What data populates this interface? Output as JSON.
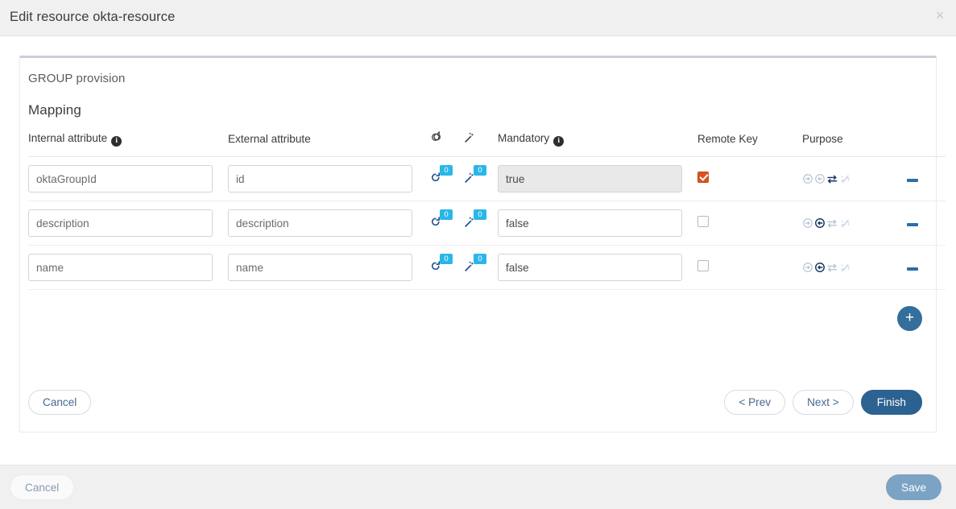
{
  "header": {
    "title": "Edit resource okta-resource",
    "close_label": "×"
  },
  "panel": {
    "provision_title": "GROUP provision",
    "section_title": "Mapping"
  },
  "table": {
    "headers": {
      "internal": "Internal attribute",
      "external": "External attribute",
      "refresh_icon": "refresh-icon",
      "wand_icon": "magic-wand-icon",
      "mandatory": "Mandatory",
      "remote_key": "Remote Key",
      "purpose": "Purpose",
      "info_glyph": "i"
    },
    "rows": [
      {
        "internal": "oktaGroupId",
        "external": "id",
        "refresh_badge": "0",
        "wand_badge": "0",
        "mandatory": "true",
        "mandatory_disabled": true,
        "remote_key_checked": true,
        "purpose_active_index": 2
      },
      {
        "internal": "description",
        "external": "description",
        "refresh_badge": "0",
        "wand_badge": "0",
        "mandatory": "false",
        "mandatory_disabled": false,
        "remote_key_checked": false,
        "purpose_active_index": 1
      },
      {
        "internal": "name",
        "external": "name",
        "refresh_badge": "0",
        "wand_badge": "0",
        "mandatory": "false",
        "mandatory_disabled": false,
        "remote_key_checked": false,
        "purpose_active_index": 1
      }
    ],
    "add_label": "+",
    "remove_label": "remove-row"
  },
  "wizard_footer": {
    "cancel": "Cancel",
    "prev": "< Prev",
    "next": "Next >",
    "finish": "Finish"
  },
  "bottom_bar": {
    "cancel": "Cancel",
    "save": "Save"
  },
  "colors": {
    "accent_blue": "#2c6291",
    "badge_cyan": "#29b6e8",
    "checkbox_orange": "#d9541e",
    "icon_blue": "#1d4f91",
    "panel_top_border": "#c9cedb",
    "save_disabled": "#7ba3c4"
  }
}
